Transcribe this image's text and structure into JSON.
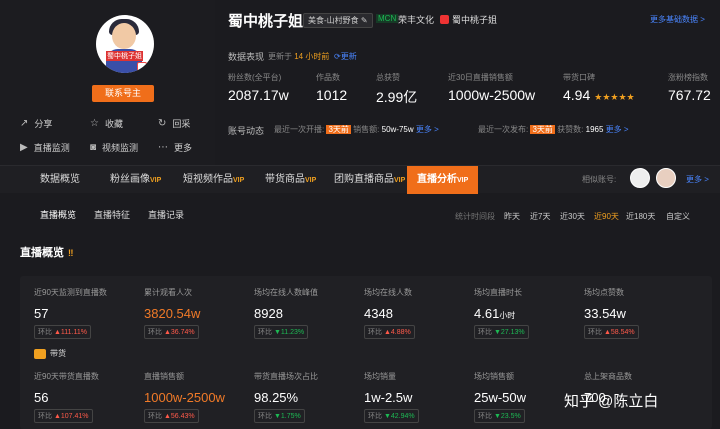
{
  "profile": {
    "avatar_text": "蜀中桃子姐",
    "contact_button": "联系号主",
    "actions": [
      {
        "icon": "share-icon",
        "label": "分享"
      },
      {
        "icon": "star-icon",
        "label": "收藏"
      },
      {
        "icon": "history-icon",
        "label": "回采"
      },
      {
        "icon": "live-monitor-icon",
        "label": "直播监测"
      },
      {
        "icon": "video-monitor-icon",
        "label": "视频监测"
      },
      {
        "icon": "more-icon",
        "label": "更多"
      }
    ]
  },
  "header": {
    "name": "蜀中桃子姐",
    "category_tag": "美食-山村野食",
    "mcn_badge": "MCN",
    "mcn_name": "荣丰文化",
    "shop_name": "蜀中桃子姐",
    "more_data_link": "更多基础数据 >"
  },
  "data_perf": {
    "label": "数据表现",
    "update_prefix": "更新于",
    "update_time": "14 小时前",
    "refresh": "更新",
    "stats": [
      {
        "label": "粉丝数(全平台)",
        "value": "2087.17w"
      },
      {
        "label": "作品数",
        "value": "1012"
      },
      {
        "label": "总获赞",
        "value": "2.99亿"
      },
      {
        "label": "近30日直播销售额",
        "value": "1000w-2500w"
      },
      {
        "label": "带货口碑",
        "value": "4.94",
        "stars": "★★★★★"
      },
      {
        "label": "涨粉榜指数",
        "value": "767.72"
      }
    ]
  },
  "account_dynamics": {
    "label": "账号动态",
    "live": {
      "prefix": "最近一次开播:",
      "ago": "3天前",
      "sales_label": "销售额:",
      "sales": "50w-75w",
      "more": "更多 >"
    },
    "video": {
      "prefix": "最近一次发布:",
      "ago": "3天前",
      "likes_label": "获赞数:",
      "likes": "1965",
      "more": "更多 >"
    }
  },
  "nav": {
    "tabs": [
      {
        "label": "数据概览",
        "vip": ""
      },
      {
        "label": "粉丝画像",
        "vip": "VIP"
      },
      {
        "label": "短视频作品",
        "vip": "VIP"
      },
      {
        "label": "带货商品",
        "vip": "VIP"
      },
      {
        "label": "团购直播商品",
        "vip": "VIP"
      },
      {
        "label": "直播分析",
        "vip": "VIP"
      }
    ],
    "similar_label": "相似账号:",
    "more": "更多 >"
  },
  "subnav": {
    "tabs": [
      "直播概览",
      "直播特征",
      "直播记录"
    ],
    "range_label": "统计时间段",
    "ranges": [
      "昨天",
      "近7天",
      "近30天",
      "近90天",
      "近180天",
      "自定义"
    ],
    "active_range": "近90天"
  },
  "overview": {
    "title": "直播概览",
    "row1": [
      {
        "label": "近90天监测到直播数",
        "value": "57",
        "cmp_label": "环比",
        "dir": "▲",
        "pct": "111.11%",
        "highlight": false
      },
      {
        "label": "累计观看人次",
        "value": "3820.54w",
        "cmp_label": "环比",
        "dir": "▲",
        "pct": "36.74%",
        "highlight": true
      },
      {
        "label": "场均在线人数峰值",
        "value": "8928",
        "cmp_label": "环比",
        "dir": "▼",
        "pct": "11.23%",
        "highlight": false
      },
      {
        "label": "场均在线人数",
        "value": "4348",
        "cmp_label": "环比",
        "dir": "▲",
        "pct": "4.88%",
        "highlight": false
      },
      {
        "label": "场均直播时长",
        "value": "4.61",
        "unit": "小时",
        "cmp_label": "环比",
        "dir": "▼",
        "pct": "27.13%",
        "highlight": false
      },
      {
        "label": "场均点赞数",
        "value": "33.54w",
        "cmp_label": "环比",
        "dir": "▲",
        "pct": "58.54%",
        "highlight": false
      }
    ],
    "daihuo_label": "带货",
    "row2": [
      {
        "label": "近90天带货直播数",
        "value": "56",
        "cmp_label": "环比",
        "dir": "▲",
        "pct": "107.41%",
        "highlight": false
      },
      {
        "label": "直播销售额",
        "value": "1000w-2500w",
        "cmp_label": "环比",
        "dir": "▲",
        "pct": "56.43%",
        "highlight": true
      },
      {
        "label": "带货直播场次占比",
        "value": "98.25%",
        "cmp_label": "环比",
        "dir": "▼",
        "pct": "1.75%",
        "highlight": false
      },
      {
        "label": "场均销量",
        "value": "1w-2.5w",
        "cmp_label": "环比",
        "dir": "▼",
        "pct": "42.94%",
        "highlight": false
      },
      {
        "label": "场均销售额",
        "value": "25w-50w",
        "cmp_label": "环比",
        "dir": "▼",
        "pct": "23.5%",
        "highlight": false
      },
      {
        "label": "总上架商品数",
        "value": "700",
        "cmp_label": "",
        "dir": "",
        "pct": "",
        "highlight": false
      }
    ]
  },
  "watermark": "知乎 @陈立白"
}
